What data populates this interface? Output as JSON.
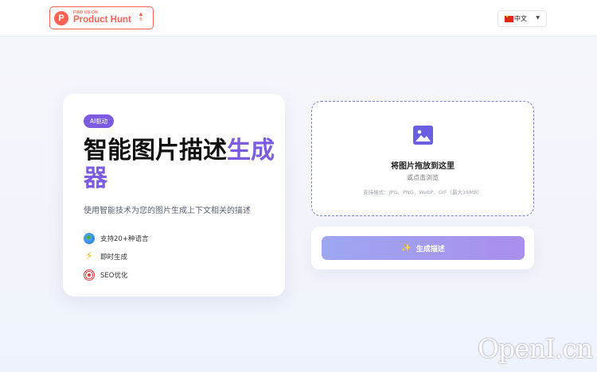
{
  "topbar": {
    "product_hunt": {
      "small_text": "FIND US ON",
      "big_text": "Product Hunt",
      "logo_letter": "P",
      "vote_arrow": "▲",
      "vote_count": "6"
    },
    "language": {
      "selected": "中文",
      "flag_icon": "china-flag-icon"
    }
  },
  "hero": {
    "badge": "AI驱动",
    "headline_part1": "智能图片描述生成器",
    "headline_part2": "生成器",
    "subtitle": "使用智能技术为您的图片生成上下文相关的描述",
    "features": [
      {
        "icon": "globe-icon",
        "label": "支持20+种语言"
      },
      {
        "icon": "lightning-icon",
        "label": "即时生成"
      },
      {
        "icon": "target-icon",
        "label": "SEO优化"
      }
    ]
  },
  "upload": {
    "title": "将图片拖放到这里",
    "subtitle": "或点击浏览",
    "formats": "支持格式：JPG、PNG、WebP、GIF（最大16MB）",
    "icon": "image-icon"
  },
  "generate": {
    "label": "生成描述",
    "icon": "sparkle-icon"
  },
  "watermark": "OpenI.cn",
  "colors": {
    "accent": "#7b5be0",
    "product_hunt": "#ff6154",
    "button_start": "#9ea6f1",
    "button_end": "#a98fec"
  }
}
